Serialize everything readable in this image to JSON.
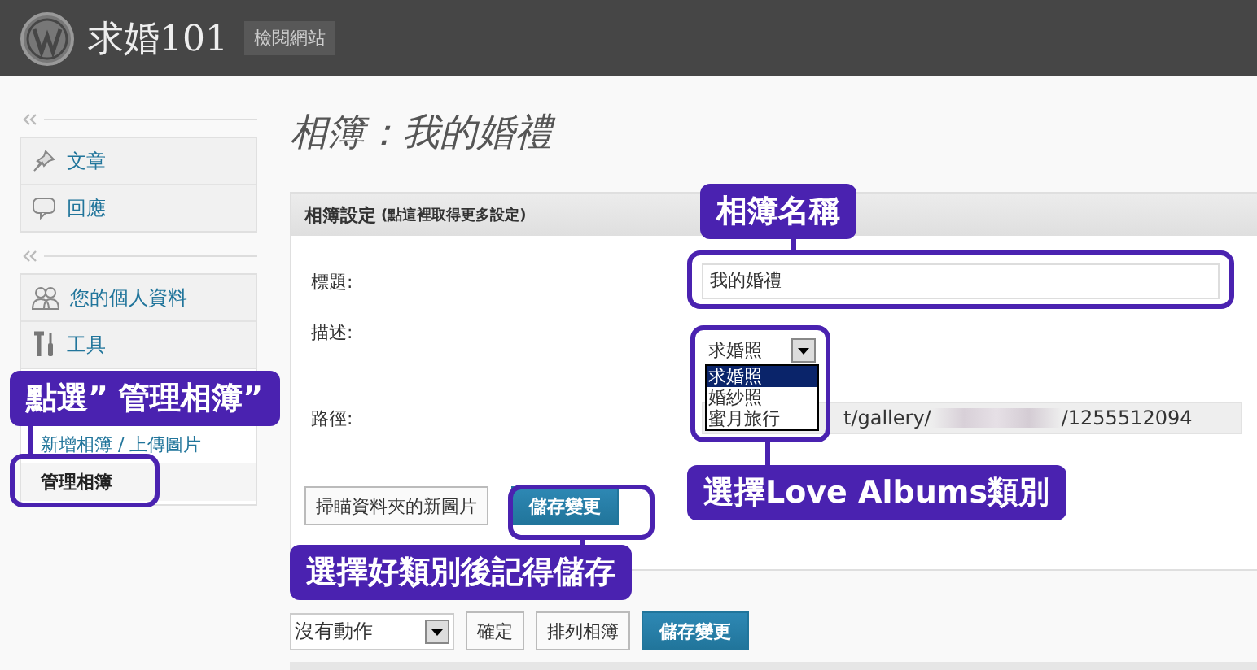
{
  "header": {
    "site_title": "求婚101",
    "view_site": "檢閱網站"
  },
  "sidebar": {
    "groups": [
      {
        "items": [
          {
            "label": "文章"
          },
          {
            "label": "回應"
          }
        ]
      },
      {
        "items": [
          {
            "label": "您的個人資料"
          },
          {
            "label": "工具"
          }
        ]
      }
    ],
    "submenu": [
      {
        "label": "新增相簿 / 上傳圖片",
        "selected": false
      },
      {
        "label": "管理相簿",
        "selected": true
      }
    ]
  },
  "page_title": "相簿：我的婚禮",
  "panel": {
    "header": "相簿設定",
    "header_hint": "(點這裡取得更多設定)",
    "fields": [
      {
        "kind": "text",
        "label": "標題:",
        "value": "我的婚禮"
      },
      {
        "kind": "select",
        "label": "描述:",
        "value": "求婚照",
        "options": [
          {
            "label": "求婚照",
            "selected": true
          },
          {
            "label": "婚紗照",
            "selected": false
          },
          {
            "label": "蜜月旅行",
            "selected": false
          }
        ]
      },
      {
        "kind": "path",
        "label": "路徑:",
        "value_start": "t/gallery/",
        "value_end": "/1255512094"
      }
    ],
    "buttons": [
      {
        "label": "掃瞄資料夾的新圖片",
        "primary": false
      },
      {
        "label": "儲存變更",
        "primary": true
      }
    ]
  },
  "bulk_actions": {
    "action": "沒有動作",
    "buttons": [
      {
        "label": "確定",
        "primary": false
      },
      {
        "label": "排列相簿",
        "primary": false
      },
      {
        "label": "儲存變更",
        "primary": true
      }
    ]
  },
  "callouts": [
    {
      "text": "相簿名稱"
    },
    {
      "text": "選擇Love Albums類別"
    },
    {
      "text": "點選” 管理相簿”"
    },
    {
      "text": "選擇好類別後記得儲存"
    }
  ]
}
